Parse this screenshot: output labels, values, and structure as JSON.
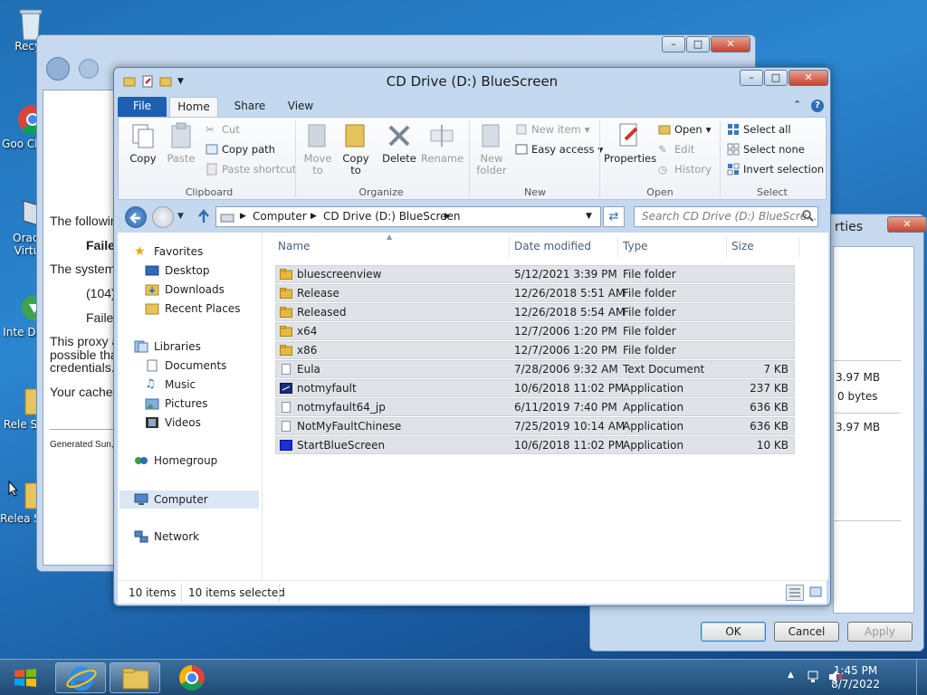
{
  "desktop": {
    "icons": [
      {
        "label": "Recyc"
      },
      {
        "label": "Goo Chro"
      },
      {
        "label": "Oracl Virtu"
      },
      {
        "label": "Inte Dow"
      },
      {
        "label": "Rele Sho"
      },
      {
        "label": "Relea Sho"
      }
    ]
  },
  "browser": {
    "lines": [
      "The followin",
      "Faile",
      "The system",
      "(104)",
      "Failed",
      "This proxy a",
      "possible tha",
      "credentials.",
      "Your cache",
      "Generated Sun,"
    ]
  },
  "properties": {
    "title_fragment": "rties",
    "values": [
      "3.97 MB",
      "0 bytes",
      "3.97 MB"
    ],
    "ok_label": "OK",
    "cancel_label": "Cancel",
    "apply_label": "Apply"
  },
  "explorer": {
    "title": "CD Drive (D:) BlueScreen",
    "tabs": {
      "file": "File",
      "home": "Home",
      "share": "Share",
      "view": "View"
    },
    "ribbon": {
      "clipboard": {
        "label": "Clipboard",
        "copy": "Copy",
        "paste": "Paste",
        "cut": "Cut",
        "copy_path": "Copy path",
        "paste_shortcut": "Paste shortcut"
      },
      "organize": {
        "label": "Organize",
        "move_to": "Move to",
        "copy_to": "Copy to",
        "delete": "Delete",
        "rename": "Rename"
      },
      "new": {
        "label": "New",
        "new_folder": "New folder",
        "new_item": "New item",
        "easy_access": "Easy access"
      },
      "open": {
        "label": "Open",
        "properties": "Properties",
        "open": "Open",
        "edit": "Edit",
        "history": "History"
      },
      "select": {
        "label": "Select",
        "select_all": "Select all",
        "select_none": "Select none",
        "invert_selection": "Invert selection"
      }
    },
    "address": {
      "computer": "Computer",
      "drive": "CD Drive (D:) BlueScreen",
      "search_placeholder": "Search CD Drive (D:) BlueScre..."
    },
    "nav": {
      "favorites": "Favorites",
      "desktop": "Desktop",
      "downloads": "Downloads",
      "recent": "Recent Places",
      "libraries": "Libraries",
      "documents": "Documents",
      "music": "Music",
      "pictures": "Pictures",
      "videos": "Videos",
      "homegroup": "Homegroup",
      "computer": "Computer",
      "network": "Network"
    },
    "columns": {
      "name": "Name",
      "date": "Date modified",
      "type": "Type",
      "size": "Size"
    },
    "files": [
      {
        "name": "bluescreenview",
        "date": "5/12/2021 3:39 PM",
        "type": "File folder",
        "size": "",
        "icon": "folder-icon"
      },
      {
        "name": "Release",
        "date": "12/26/2018 5:51 AM",
        "type": "File folder",
        "size": "",
        "icon": "folder-icon"
      },
      {
        "name": "Released",
        "date": "12/26/2018 5:54 AM",
        "type": "File folder",
        "size": "",
        "icon": "folder-icon"
      },
      {
        "name": "x64",
        "date": "12/7/2006 1:20 PM",
        "type": "File folder",
        "size": "",
        "icon": "folder-icon"
      },
      {
        "name": "x86",
        "date": "12/7/2006 1:20 PM",
        "type": "File folder",
        "size": "",
        "icon": "folder-icon"
      },
      {
        "name": "Eula",
        "date": "7/28/2006 9:32 AM",
        "type": "Text Document",
        "size": "7 KB",
        "icon": "document-icon"
      },
      {
        "name": "notmyfault",
        "date": "10/6/2018 11:02 PM",
        "type": "Application",
        "size": "237 KB",
        "icon": "app-icon"
      },
      {
        "name": "notmyfault64_jp",
        "date": "6/11/2019 7:40 PM",
        "type": "Application",
        "size": "636 KB",
        "icon": "blank-app-icon"
      },
      {
        "name": "NotMyFaultChinese",
        "date": "7/25/2019 10:14 AM",
        "type": "Application",
        "size": "636 KB",
        "icon": "blank-app-icon"
      },
      {
        "name": "StartBlueScreen",
        "date": "10/6/2018 11:02 PM",
        "type": "Application",
        "size": "10 KB",
        "icon": "bluescreen-app-icon"
      }
    ],
    "status": {
      "count": "10 items",
      "selected": "10 items selected"
    }
  },
  "taskbar": {
    "time": "1:45 PM",
    "date": "8/7/2022"
  },
  "colors": {
    "file_tab": "#1f5fb0",
    "folder": "#e8b83c",
    "selection": "#dfe3e8"
  }
}
